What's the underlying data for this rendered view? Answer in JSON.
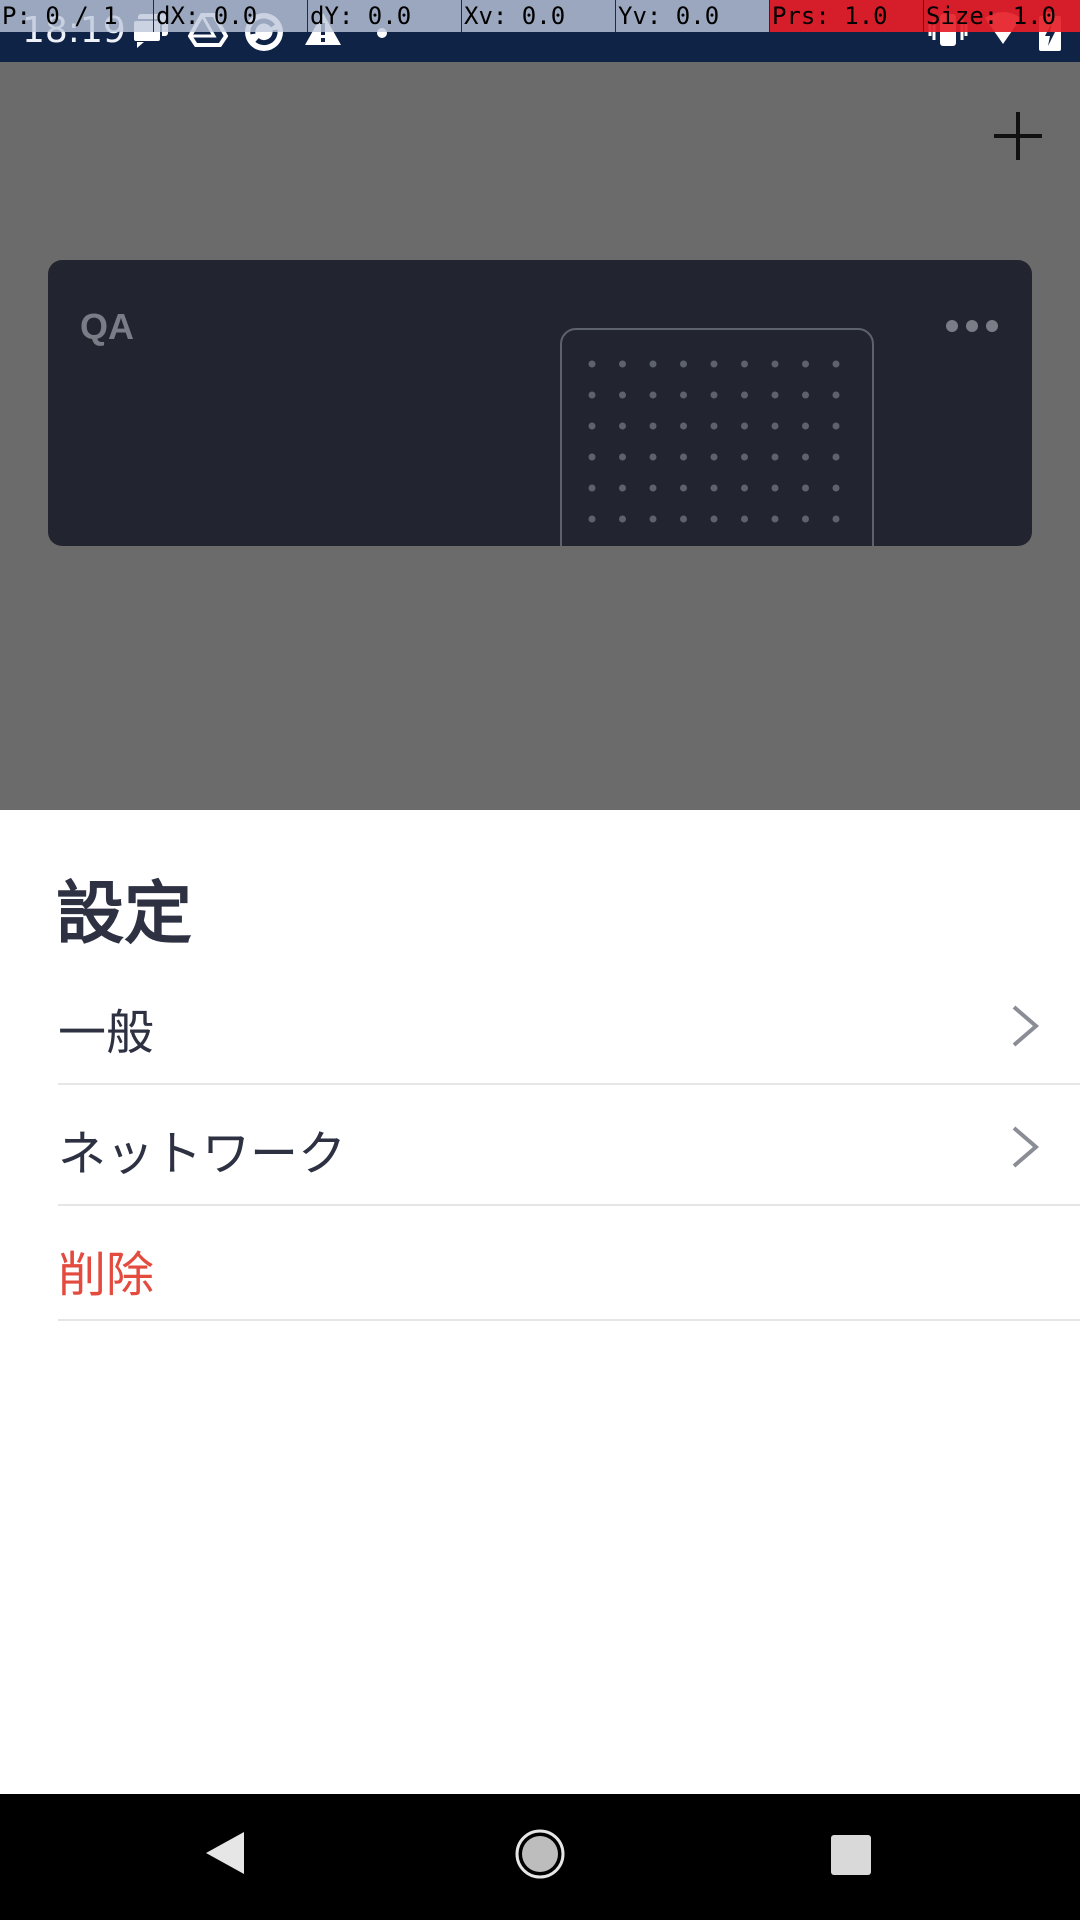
{
  "status_bar": {
    "time": "18:19",
    "left_icons": [
      "chat-icon",
      "drive-icon",
      "sync-app-icon",
      "warning-icon",
      "dot-icon"
    ],
    "right_icons": [
      "vibrate-icon",
      "wifi-icon",
      "battery-icon"
    ]
  },
  "debug_overlay": {
    "cells": [
      "P: 0 / 1",
      "dX: 0.0",
      "dY: 0.0",
      "Xv: 0.0",
      "Yv: 0.0",
      "Prs: 1.0",
      "Size: 1.0"
    ],
    "alert_color": "#e61e28"
  },
  "toolbar": {
    "add_icon": "plus-icon"
  },
  "device_card": {
    "name": "QA",
    "more_icon": "more-horizontal-icon",
    "image_icon": "device-dot-grid-icon"
  },
  "sheet": {
    "title": "設定",
    "items": [
      {
        "label": "一般",
        "icon": "chevron-right-icon"
      },
      {
        "label": "ネットワーク",
        "icon": "chevron-right-icon"
      },
      {
        "label": "削除",
        "color": "#e44b3f"
      }
    ]
  },
  "nav_bar": {
    "buttons": [
      "back-icon",
      "home-icon",
      "recents-icon"
    ]
  },
  "colors": {
    "status_bar": "#0f2347",
    "card": "#22252f",
    "scrim": "#6b6b6b",
    "text_primary": "#2d3142",
    "danger": "#e44b3f"
  }
}
